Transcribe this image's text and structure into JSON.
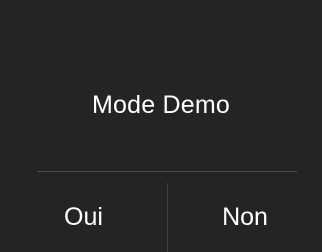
{
  "dialog": {
    "title": "Mode Demo",
    "yes_label": "Oui",
    "no_label": "Non"
  },
  "colors": {
    "background": "#222524",
    "text": "#ffffff",
    "divider": "#4b4d4d"
  }
}
